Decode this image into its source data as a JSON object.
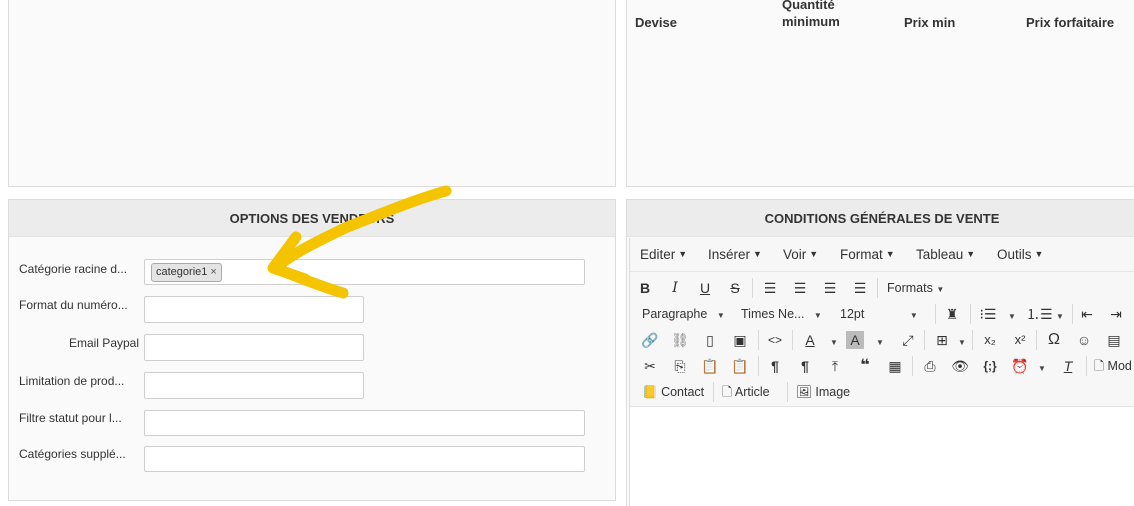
{
  "price_table": {
    "headers": {
      "devise": "Devise",
      "quantite_minimum": "Quantité\nminimum",
      "prix_min": "Prix min",
      "prix_forfaitaire": "Prix forfaitaire"
    }
  },
  "vendors_panel": {
    "title": "OPTIONS DES VENDEURS",
    "fields": [
      {
        "label": "Catégorie racine d...",
        "tag": "categorie1",
        "tag_remove": "×"
      },
      {
        "label": "Format du numéro...",
        "value": ""
      },
      {
        "label": "Email Paypal",
        "value": ""
      },
      {
        "label": "Limitation de prod...",
        "value": ""
      },
      {
        "label": "Filtre statut pour l...",
        "value": ""
      },
      {
        "label": "Catégories supplé...",
        "value": ""
      }
    ]
  },
  "cgv_panel": {
    "title": "CONDITIONS GÉNÉRALES DE VENTE",
    "menubar": [
      "Editer",
      "Insérer",
      "Voir",
      "Format",
      "Tableau",
      "Outils"
    ],
    "toolbar": {
      "formats_label": "Formats",
      "block_format": "Paragraphe",
      "font_family": "Times Ne...",
      "font_size": "12pt",
      "contact_label": "Contact",
      "article_label": "Article",
      "image_label": "Image",
      "more_label": "Mod"
    }
  },
  "colors": {
    "arrow": "#f5c400",
    "panel_header_bg": "#ececec"
  }
}
